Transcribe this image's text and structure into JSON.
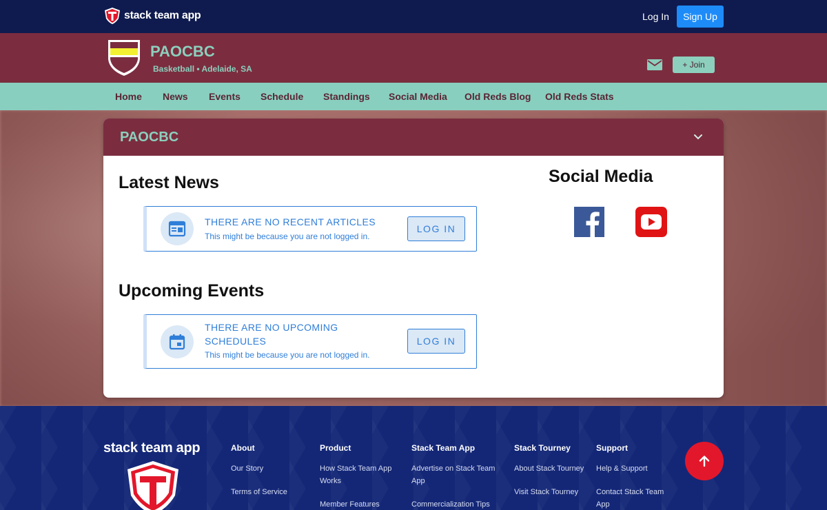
{
  "topbar": {
    "brand": "stack team app",
    "login": "Log In",
    "signup": "Sign Up"
  },
  "team": {
    "name": "PAOCBC",
    "subtitle": "Basketball • Adelaide, SA",
    "join": "+ Join"
  },
  "nav": [
    "Home",
    "News",
    "Events",
    "Schedule",
    "Standings",
    "Social Media",
    "Old Reds Blog",
    "Old Reds Stats"
  ],
  "card": {
    "title": "PAOCBC",
    "news": {
      "heading": "Latest News",
      "empty_title": "THERE ARE NO RECENT ARTICLES",
      "empty_sub": "This might be because you are not logged in.",
      "button": "LOG IN"
    },
    "events": {
      "heading": "Upcoming Events",
      "empty_title": "THERE ARE NO UPCOMING SCHEDULES",
      "empty_sub": "This might be because you are not logged in.",
      "button": "LOG IN"
    },
    "social": {
      "heading": "Social Media"
    }
  },
  "footer": {
    "brand": "stack team app",
    "columns": [
      {
        "head": "About",
        "links": [
          "Our Story",
          "Terms of Service"
        ]
      },
      {
        "head": "Product",
        "links": [
          "How Stack Team App Works",
          "Member Features"
        ]
      },
      {
        "head": "Stack Team App",
        "links": [
          "Advertise on Stack Team App",
          "Commercialization Tips"
        ]
      },
      {
        "head": "Stack Tourney",
        "links": [
          "About Stack Tourney",
          "Visit Stack Tourney"
        ]
      },
      {
        "head": "Support",
        "links": [
          "Help & Support",
          "Contact Stack Team App"
        ]
      }
    ]
  },
  "colors": {
    "navy": "#0f1b4f",
    "maroon": "#7b2d3f",
    "mint": "#89cfbf",
    "blue": "#2f7ed8",
    "red": "#e3172b"
  }
}
